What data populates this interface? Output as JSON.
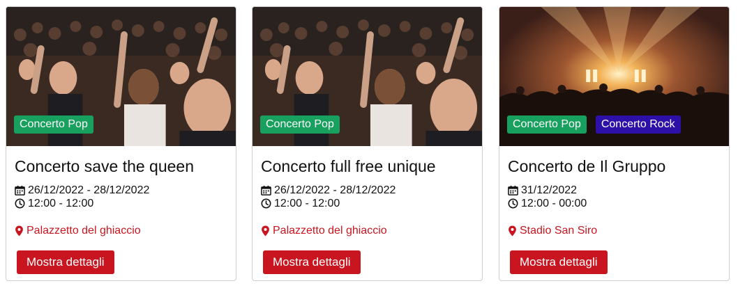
{
  "events": [
    {
      "image": "crowd-cheering-photo",
      "tags": [
        {
          "label": "Concerto Pop",
          "color": "#18a05e"
        }
      ],
      "title": "Concerto save the queen",
      "dates": "26/12/2022 - 28/12/2022",
      "times": "12:00 - 12:00",
      "venue": "Palazzetto del ghiaccio",
      "button": "Mostra dettagli"
    },
    {
      "image": "crowd-cheering-photo",
      "tags": [
        {
          "label": "Concerto Pop",
          "color": "#18a05e"
        }
      ],
      "title": "Concerto full free unique",
      "dates": "26/12/2022 - 28/12/2022",
      "times": "12:00 - 12:00",
      "venue": "Palazzetto del ghiaccio",
      "button": "Mostra dettagli"
    },
    {
      "image": "concert-stage-lights-photo",
      "tags": [
        {
          "label": "Concerto Pop",
          "color": "#18a05e"
        },
        {
          "label": "Concerto Rock",
          "color": "#2c10a8"
        }
      ],
      "title": "Concerto de Il Gruppo",
      "dates": "31/12/2022",
      "times": "12:00 - 00:00",
      "venue": "Stadio San Siro",
      "button": "Mostra dettagli"
    }
  ],
  "colors": {
    "accent": "#c8151f",
    "pop": "#18a05e",
    "rock": "#2c10a8"
  },
  "icons": {
    "date": "calendar-icon",
    "time": "clock-icon",
    "venue": "map-pin-icon"
  }
}
